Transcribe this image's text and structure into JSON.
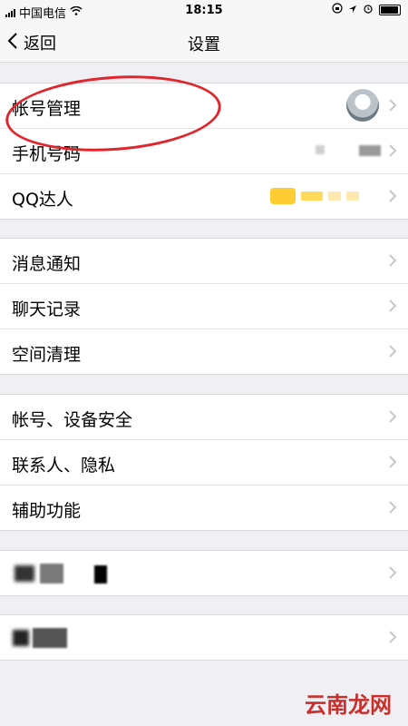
{
  "status_bar": {
    "carrier": "中国电信",
    "time": "18:15"
  },
  "nav": {
    "back_label": "返回",
    "title": "设置"
  },
  "groups": [
    {
      "items": [
        {
          "label": "帐号管理"
        },
        {
          "label": "手机号码"
        },
        {
          "label": "QQ达人"
        }
      ]
    },
    {
      "items": [
        {
          "label": "消息通知"
        },
        {
          "label": "聊天记录"
        },
        {
          "label": "空间清理"
        }
      ]
    },
    {
      "items": [
        {
          "label": "帐号、设备安全"
        },
        {
          "label": "联系人、隐私"
        },
        {
          "label": "辅助功能"
        }
      ]
    },
    {
      "items": [
        {
          "label": ""
        }
      ]
    },
    {
      "items": [
        {
          "label": ""
        }
      ]
    }
  ],
  "watermark": "云南龙网",
  "colors": {
    "annotation": "#e0262c",
    "background": "#efeff4"
  }
}
